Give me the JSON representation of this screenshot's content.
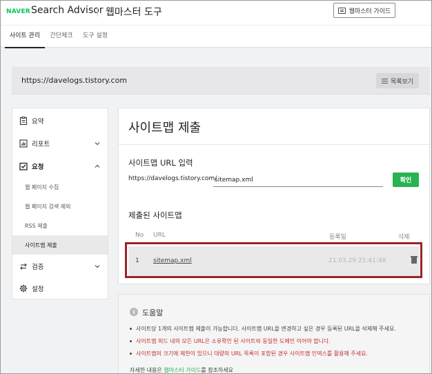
{
  "header": {
    "logo": "NAVER",
    "product": "Search Advisor",
    "tool_title": "웹마스터 도구",
    "guide_button": "웹마스터 가이드"
  },
  "tabs": [
    {
      "label": "사이트 관리",
      "active": true
    },
    {
      "label": "간단체크",
      "active": false
    },
    {
      "label": "도구 설정",
      "active": false
    }
  ],
  "site": {
    "url": "https://davelogs.tistory.com",
    "list_button": "목록보기"
  },
  "sidebar": {
    "items": [
      {
        "label": "요약",
        "icon": "clipboard-icon"
      },
      {
        "label": "리포트",
        "icon": "bar-chart-icon",
        "chevron": "down"
      },
      {
        "label": "요청",
        "icon": "checkbox-icon",
        "chevron": "up"
      },
      {
        "label": "검증",
        "icon": "sync-icon",
        "chevron": "down"
      },
      {
        "label": "설정",
        "icon": "gear-icon"
      }
    ],
    "sub_items": [
      {
        "label": "웹 페이지 수집",
        "active": false
      },
      {
        "label": "웹 페이지 검색 제외",
        "active": false
      },
      {
        "label": "RSS 제출",
        "active": false
      },
      {
        "label": "사이트맵 제출",
        "active": true
      }
    ]
  },
  "main": {
    "title": "사이트맵 제출",
    "url_input_label": "사이트맵 URL 입력",
    "url_prefix": "https://davelogs.tistory.com/",
    "url_input_value": "sitemap.xml",
    "confirm_button": "확인",
    "submitted_heading": "제출된 사이트맵",
    "table": {
      "headers": {
        "no": "No",
        "url": "URL",
        "date": "등록일",
        "delete": "삭제"
      },
      "rows": [
        {
          "no": "1",
          "url": "sitemap.xml",
          "date": "21.03.29 21:41:48"
        }
      ]
    }
  },
  "help": {
    "title": "도움말",
    "lines": [
      "사이트당 1개의 사이트맵 제출이 가능합니다. 사이트맵 URL을 변경하고 싶은 경우 등록된 URL을 삭제해 주세요.",
      "사이트맵 피드 내의 모든 URL은 소유확인 된 사이트와 동일한 도메인 이어야 합니다.",
      "사이트맵의 크기에 제한이 있으니 대량의 URL 목록이 포함된 경우 사이트맵 인덱스를 활용해 주세요."
    ],
    "footer_prefix": "자세한 내용은 ",
    "footer_link": "웹마스터 가이드",
    "footer_suffix": "를 참조하세요"
  },
  "colors": {
    "brand_green": "#03c75a",
    "button_green": "#29b352",
    "warning_red": "#c0302c",
    "highlight_border": "#9b2326"
  }
}
